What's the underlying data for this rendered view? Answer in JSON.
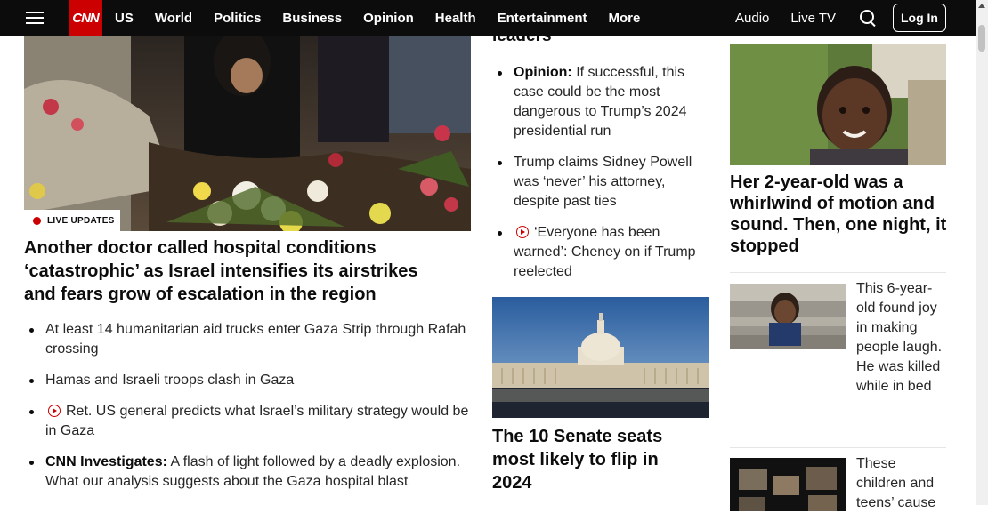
{
  "nav": {
    "logo": "CNN",
    "links": [
      "US",
      "World",
      "Politics",
      "Business",
      "Opinion",
      "Health",
      "Entertainment",
      "More"
    ],
    "right_links": [
      "Audio",
      "Live TV"
    ],
    "login": "Log In"
  },
  "hero": {
    "badge": "LIVE UPDATES",
    "headline": "Another doctor called hospital conditions ‘catastrophic’ as Israel intensifies its airstrikes and fears grow of escalation in the region",
    "bullets": [
      {
        "label": "",
        "video": false,
        "text": "At least 14 humanitarian aid trucks enter Gaza Strip through Rafah crossing"
      },
      {
        "label": "",
        "video": false,
        "text": "Hamas and Israeli troops clash in Gaza"
      },
      {
        "label": "",
        "video": true,
        "text": "Ret. US general predicts what Israel’s military strategy would be in Gaza"
      },
      {
        "label": "CNN Investigates:",
        "video": false,
        "text": "A flash of light followed by a deadly explosion. What our analysis suggests about the Gaza hospital blast"
      }
    ]
  },
  "middle": {
    "top_fragment": "leaders",
    "bullets": [
      {
        "label": "Opinion:",
        "video": false,
        "text": "If successful, this case could be the most dangerous to Trump’s 2024 presidential run"
      },
      {
        "label": "",
        "video": false,
        "text": "Trump claims Sidney Powell was ‘never’ his attorney, despite past ties"
      },
      {
        "label": "",
        "video": true,
        "text": "‘Everyone has been warned’: Cheney on if Trump reelected"
      }
    ],
    "senate_headline": "The 10 Senate seats most likely to flip in 2024"
  },
  "right": {
    "headline": "Her 2-year-old was a whirlwind of motion and sound. Then, one night, it stopped",
    "story1": "This 6-year-old found joy in making people laugh. He was killed while in bed",
    "story2": "These children and teens’ cause"
  },
  "colors": {
    "brand_red": "#cc0000",
    "nav_bg": "#0c0c0c"
  }
}
